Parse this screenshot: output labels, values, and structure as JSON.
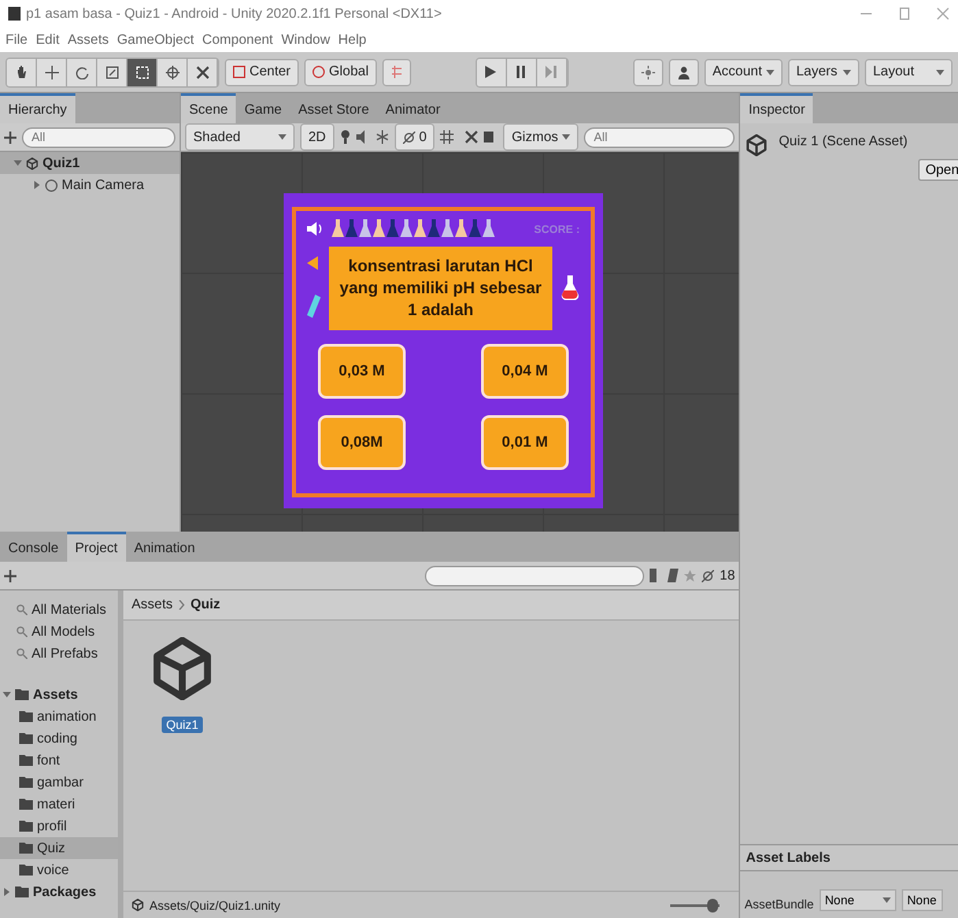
{
  "window": {
    "title": "p1 asam basa - Quiz1 - Android - Unity 2020.2.1f1 Personal <DX11>"
  },
  "menu": [
    "File",
    "Edit",
    "Assets",
    "GameObject",
    "Component",
    "Window",
    "Help"
  ],
  "toolbar": {
    "pivot": "Center",
    "space": "Global",
    "account": "Account",
    "layers": "Layers",
    "layout": "Layout"
  },
  "hierarchy": {
    "title": "Hierarchy",
    "search_placeholder": "All",
    "items": [
      {
        "label": "Quiz1",
        "expanded": true,
        "children": [
          {
            "label": "Main Camera",
            "expanded": false
          }
        ]
      }
    ]
  },
  "scene": {
    "tabs": [
      {
        "label": "Scene",
        "selected": true
      },
      {
        "label": "Game",
        "selected": false
      },
      {
        "label": "Asset Store",
        "selected": false
      },
      {
        "label": "Animator",
        "selected": false
      }
    ],
    "shading": "Shaded",
    "mode": "2D",
    "hidden_count": "0",
    "gizmos": "Gizmos",
    "search_placeholder": "All",
    "game": {
      "score": "SCORE :",
      "question": "konsentrasi larutan HCl yang memiliki pH sebesar 1 adalah",
      "answers": [
        "0,03 M",
        "0,04 M",
        "0,08M",
        "0,01 M"
      ]
    }
  },
  "project": {
    "tabs": [
      {
        "label": "Console",
        "selected": false
      },
      {
        "label": "Project",
        "selected": true
      },
      {
        "label": "Animation",
        "selected": false
      }
    ],
    "layer_count": "18",
    "favorites": [
      "All Materials",
      "All Models",
      "All Prefabs"
    ],
    "tree": [
      {
        "label": "Assets",
        "expanded": true,
        "selected": false,
        "children": [
          {
            "label": "animation",
            "selected": false
          },
          {
            "label": "coding",
            "selected": false
          },
          {
            "label": "font",
            "selected": false
          },
          {
            "label": "gambar",
            "selected": false
          },
          {
            "label": "materi",
            "selected": false
          },
          {
            "label": "profil",
            "selected": false
          },
          {
            "label": "Quiz",
            "selected": true
          },
          {
            "label": "voice",
            "selected": false
          }
        ]
      },
      {
        "label": "Packages",
        "expanded": false,
        "selected": false
      }
    ],
    "breadcrumb": [
      "Assets",
      "Quiz"
    ],
    "assets": [
      {
        "label": "Quiz1",
        "selected": true
      }
    ],
    "path": "Assets/Quiz/Quiz1.unity",
    "icon_size": {
      "level": 0.85
    }
  },
  "inspector": {
    "title": "Inspector",
    "asset": "Quiz 1 (Scene Asset)",
    "open": "Open",
    "labels_title": "Asset Labels",
    "bundle_label": "AssetBundle",
    "bundle": "None",
    "variant": "None"
  }
}
